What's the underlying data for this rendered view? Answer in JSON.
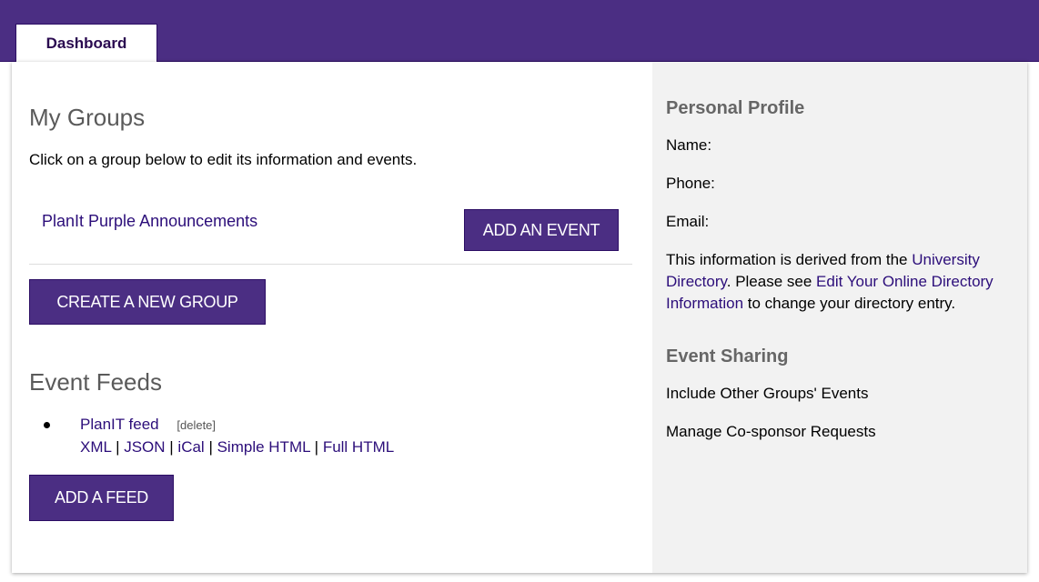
{
  "header": {
    "tabs": [
      {
        "label": "Dashboard",
        "active": true
      }
    ],
    "accent_color": "#4b2e83"
  },
  "main": {
    "my_groups": {
      "title": "My Groups",
      "description": "Click on a group below to edit its information and events.",
      "groups": [
        {
          "name": "PlanIt Purple Announcements",
          "action_label": "ADD AN EVENT"
        }
      ],
      "create_button": "CREATE A NEW GROUP"
    },
    "event_feeds": {
      "title": "Event Feeds",
      "feeds": [
        {
          "name": "PlanIT feed",
          "delete_label": "[delete]",
          "formats": [
            "XML",
            "JSON",
            "iCal",
            "Simple HTML",
            "Full HTML"
          ],
          "separator": "|"
        }
      ],
      "add_button": "ADD A FEED"
    }
  },
  "sidebar": {
    "profile": {
      "title": "Personal Profile",
      "name_label": "Name:",
      "phone_label": "Phone:",
      "email_label": "Email:",
      "info_text_1": "This information is derived from the ",
      "info_link_1": "University Directory",
      "info_text_2": ". Please see ",
      "info_link_2": "Edit Your Online Directory Information",
      "info_text_3": " to change your directory entry."
    },
    "sharing": {
      "title": "Event Sharing",
      "links": [
        "Include Other Groups' Events",
        "Manage Co-sponsor Requests"
      ]
    }
  }
}
